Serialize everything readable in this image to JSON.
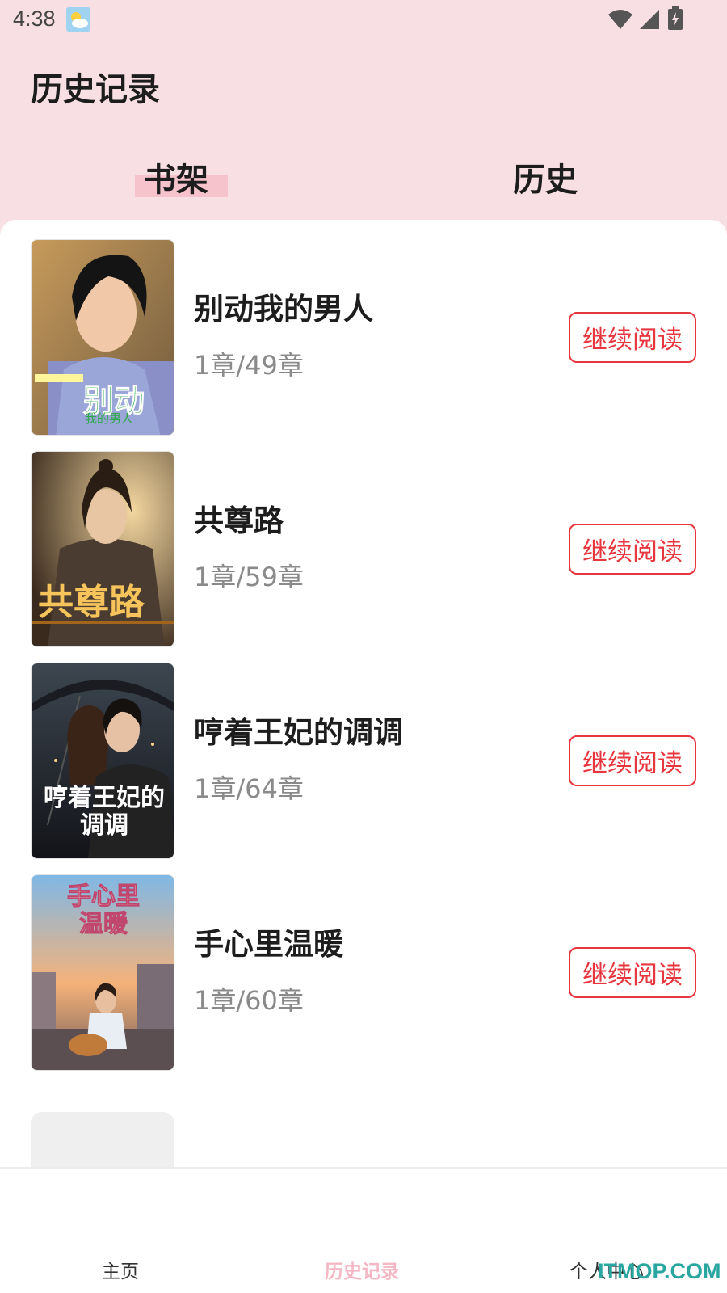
{
  "status_bar": {
    "time": "4:38"
  },
  "header": {
    "title": "历史记录"
  },
  "tabs": [
    {
      "label": "书架",
      "active": true
    },
    {
      "label": "历史",
      "active": false
    }
  ],
  "books": [
    {
      "title": "别动我的男人",
      "progress": "1章/49章",
      "action": "继续阅读",
      "cover_text": "别动",
      "cover_sub": "我的男人"
    },
    {
      "title": "共尊路",
      "progress": "1章/59章",
      "action": "继续阅读",
      "cover_text": "共尊路"
    },
    {
      "title": "哼着王妃的调调",
      "progress": "1章/64章",
      "action": "继续阅读",
      "cover_text": "哼着王妃的调调"
    },
    {
      "title": "手心里温暖",
      "progress": "1章/60章",
      "action": "继续阅读",
      "cover_text": "手心里温暖"
    }
  ],
  "bottom_nav": [
    {
      "label": "主页",
      "active": false
    },
    {
      "label": "历史记录",
      "active": true
    },
    {
      "label": "个人中心",
      "active": false
    }
  ],
  "watermark": "ITMOP.COM",
  "colors": {
    "accent_red": "#e8363f",
    "active_pink": "#f4b8c4",
    "header_bg": "#f8dfe3"
  }
}
